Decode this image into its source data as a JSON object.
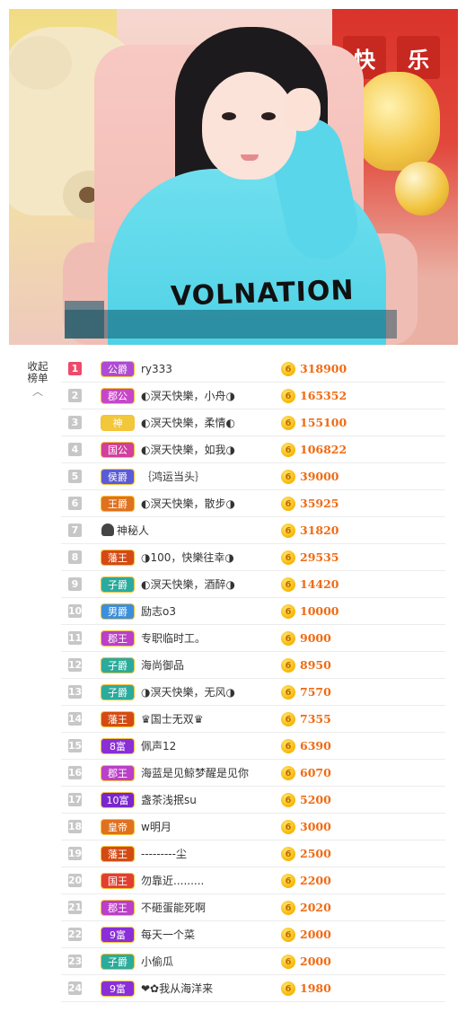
{
  "video": {
    "shirt_text": "VOLNATION",
    "sign_chars": [
      "快",
      "乐"
    ]
  },
  "sidebar": {
    "collapse_label_line1": "收起",
    "collapse_label_line2": "榜单",
    "caret": "︿"
  },
  "coin_glyph": "6",
  "ranking": [
    {
      "rank": "1",
      "badge": "公爵",
      "badge_color": "#b04ad4",
      "name": "ry333",
      "score": "318900"
    },
    {
      "rank": "2",
      "badge": "郡公",
      "badge_color": "#c646c8",
      "name": "◐溟天快樂，小舟◑",
      "score": "165352"
    },
    {
      "rank": "3",
      "badge": "神",
      "badge_color": "#f2c73a",
      "name": "◐溟天快樂，柔情◐",
      "score": "155100"
    },
    {
      "rank": "4",
      "badge": "国公",
      "badge_color": "#d0409c",
      "name": "◐溟天快樂，如我◑",
      "score": "106822"
    },
    {
      "rank": "5",
      "badge": "侯爵",
      "badge_color": "#5b5bd6",
      "name": "｛鸿运当头｝",
      "score": "39000"
    },
    {
      "rank": "6",
      "badge": "王爵",
      "badge_color": "#e0711f",
      "name": "◐溟天快樂，散步◑",
      "score": "35925"
    },
    {
      "rank": "7",
      "badge": "",
      "badge_color": "",
      "name": "神秘人",
      "score": "31820",
      "mystery": true
    },
    {
      "rank": "8",
      "badge": "藩王",
      "badge_color": "#d44a14",
      "name": "◑100，快樂往幸◑",
      "score": "29535"
    },
    {
      "rank": "9",
      "badge": "子爵",
      "badge_color": "#2bab9c",
      "name": "◐溟天快樂，酒醉◑",
      "score": "14420"
    },
    {
      "rank": "10",
      "badge": "男爵",
      "badge_color": "#3c8fdc",
      "name": "励志o3",
      "score": "10000"
    },
    {
      "rank": "11",
      "badge": "郡王",
      "badge_color": "#bb3fc7",
      "name": "专职临时工。",
      "score": "9000"
    },
    {
      "rank": "12",
      "badge": "子爵",
      "badge_color": "#2bab9c",
      "name": "海尚御品",
      "score": "8950"
    },
    {
      "rank": "13",
      "badge": "子爵",
      "badge_color": "#2bab9c",
      "name": "◑溟天快樂，无风◑",
      "score": "7570"
    },
    {
      "rank": "14",
      "badge": "藩王",
      "badge_color": "#d44a14",
      "name": "♛国士无双♛",
      "score": "7355"
    },
    {
      "rank": "15",
      "badge": "8富",
      "badge_color": "#8a2fd6",
      "name": "佩声12",
      "score": "6390"
    },
    {
      "rank": "16",
      "badge": "郡王",
      "badge_color": "#bb3fc7",
      "name": "海蓝是见鲸梦醒是见你",
      "score": "6070"
    },
    {
      "rank": "17",
      "badge": "10富",
      "badge_color": "#7a26cc",
      "name": "盏茶浅抿su",
      "score": "5200"
    },
    {
      "rank": "18",
      "badge": "皇帝",
      "badge_color": "#e0711f",
      "name": "w明月",
      "score": "3000"
    },
    {
      "rank": "19",
      "badge": "藩王",
      "badge_color": "#d44a14",
      "name": "---------尘",
      "score": "2500"
    },
    {
      "rank": "20",
      "badge": "国王",
      "badge_color": "#e04030",
      "name": "勿靠近.........",
      "score": "2200"
    },
    {
      "rank": "21",
      "badge": "郡王",
      "badge_color": "#bb3fc7",
      "name": "不砸蛋能死啊",
      "score": "2020"
    },
    {
      "rank": "22",
      "badge": "9富",
      "badge_color": "#8a2fd6",
      "name": "每天一个菜",
      "score": "2000"
    },
    {
      "rank": "23",
      "badge": "子爵",
      "badge_color": "#2bab9c",
      "name": "小偷瓜",
      "score": "2000"
    },
    {
      "rank": "24",
      "badge": "9富",
      "badge_color": "#8a2fd6",
      "name": "❤✿我从海洋来",
      "score": "1980"
    }
  ]
}
